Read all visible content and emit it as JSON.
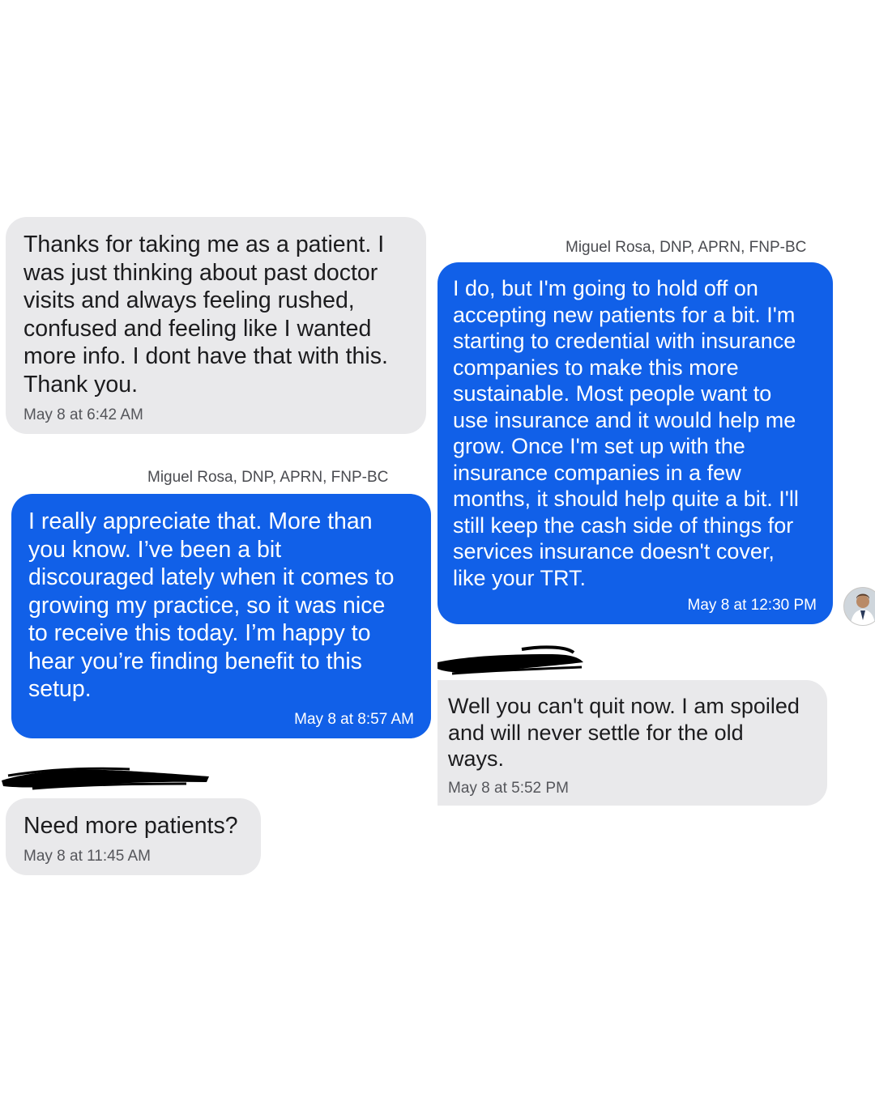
{
  "messages": [
    {
      "id": "m1",
      "direction": "incoming",
      "text": "Thanks for taking me as a patient. I\nwas just thinking about past doctor\nvisits and always feeling rushed,\nconfused and feeling like I wanted\nmore info. I dont have that with this.\nThank you.",
      "timestamp": "May 8 at 6:42 AM"
    },
    {
      "id": "m2",
      "direction": "outgoing",
      "sender": "Miguel Rosa, DNP, APRN, FNP-BC",
      "text": "I really appreciate that. More than\nyou know. I’ve been a bit\ndiscouraged lately when it comes to\ngrowing my practice, so it was nice\nto receive this today. I’m happy to\nhear you’re finding benefit to this\nsetup.",
      "timestamp": "May 8 at 8:57 AM"
    },
    {
      "id": "m3",
      "direction": "incoming",
      "sender_redacted": true,
      "text": "Need more patients?",
      "timestamp": "May 8 at 11:45 AM"
    },
    {
      "id": "m4",
      "direction": "outgoing",
      "sender": "Miguel Rosa, DNP, APRN, FNP-BC",
      "text": "I do, but I'm going to hold off on\naccepting new patients for a bit. I'm\nstarting to credential with insurance\ncompanies to make this more\nsustainable. Most people want to\nuse insurance and it would help me\ngrow. Once I'm set up with the\ninsurance companies in a few\nmonths, it should help quite a bit. I'll\nstill keep the cash side of things for\nservices insurance doesn't cover,\nlike your TRT.",
      "timestamp": "May 8 at 12:30 PM"
    },
    {
      "id": "m5",
      "direction": "incoming",
      "sender_redacted": true,
      "text": "Well you can't quit now. I am spoiled\nand will never settle for the old\nways.",
      "timestamp": "May 8 at 5:52 PM"
    }
  ],
  "colors": {
    "incoming_bubble": "#e9e9eb",
    "outgoing_bubble": "#1160e8",
    "redaction": "#000000"
  },
  "icons": {
    "avatar": "avatar-photo",
    "redaction": "redaction-scribble"
  }
}
